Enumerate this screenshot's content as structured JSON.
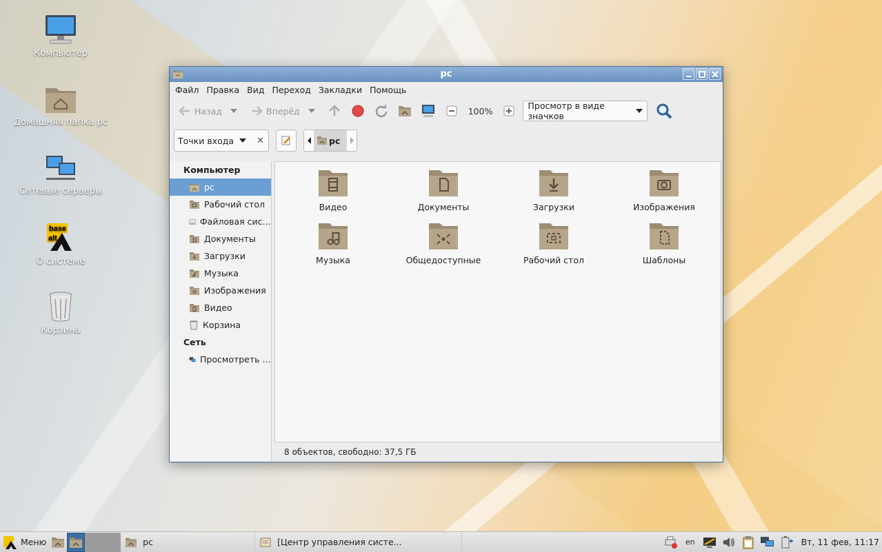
{
  "desktop": {
    "icons": [
      {
        "label": "Компьютер",
        "icon": "computer-icon"
      },
      {
        "label": "Домашняя папка pc",
        "icon": "home-folder-icon"
      },
      {
        "label": "Сетевые серверы",
        "icon": "network-icon"
      },
      {
        "label": "О системе",
        "icon": "basealt-logo"
      },
      {
        "label": "Корзина",
        "icon": "trash-icon"
      }
    ]
  },
  "window": {
    "title": "pc",
    "menu": [
      "Файл",
      "Правка",
      "Вид",
      "Переход",
      "Закладки",
      "Помощь"
    ],
    "toolbar": {
      "back_label": "Назад",
      "forward_label": "Вперёд",
      "zoom": "100%",
      "view_mode": "Просмотр в виде значков"
    },
    "location": {
      "places_label": "Точки входа",
      "crumb": "pc"
    },
    "sidebar": {
      "computer_header": "Компьютер",
      "computer_items": [
        {
          "label": "pc",
          "icon": "home-folder-icon",
          "active": true
        },
        {
          "label": "Рабочий стол",
          "icon": "desktop-folder-icon"
        },
        {
          "label": "Файловая сис…",
          "icon": "drive-icon"
        },
        {
          "label": "Документы",
          "icon": "documents-folder-icon"
        },
        {
          "label": "Загрузки",
          "icon": "downloads-folder-icon"
        },
        {
          "label": "Музыка",
          "icon": "music-folder-icon"
        },
        {
          "label": "Изображения",
          "icon": "pictures-folder-icon"
        },
        {
          "label": "Видео",
          "icon": "video-folder-icon"
        },
        {
          "label": "Корзина",
          "icon": "trash-icon"
        }
      ],
      "network_header": "Сеть",
      "network_items": [
        {
          "label": "Просмотреть …",
          "icon": "network-icon"
        }
      ]
    },
    "folders": [
      {
        "label": "Видео",
        "icon": "video-folder-icon"
      },
      {
        "label": "Документы",
        "icon": "documents-folder-icon"
      },
      {
        "label": "Загрузки",
        "icon": "downloads-folder-icon"
      },
      {
        "label": "Изображения",
        "icon": "pictures-folder-icon"
      },
      {
        "label": "Музыка",
        "icon": "music-folder-icon"
      },
      {
        "label": "Общедоступные",
        "icon": "public-folder-icon"
      },
      {
        "label": "Рабочий стол",
        "icon": "desktop-folder-icon"
      },
      {
        "label": "Шаблоны",
        "icon": "templates-folder-icon"
      }
    ],
    "status": "8 объектов, свободно: 37,5 ГБ"
  },
  "taskbar": {
    "menu_label": "Меню",
    "tasks": [
      {
        "label": "pc",
        "icon": "home-folder-icon"
      },
      {
        "label": "[Центр управления систе...",
        "icon": "control-center-icon"
      }
    ],
    "tray": {
      "lang": "en",
      "clock": "Вт, 11 фев, 11:17"
    }
  },
  "colors": {
    "titlebar": "#6a91c0",
    "selection": "#6b9fd3",
    "folder": "#b5a58a"
  }
}
